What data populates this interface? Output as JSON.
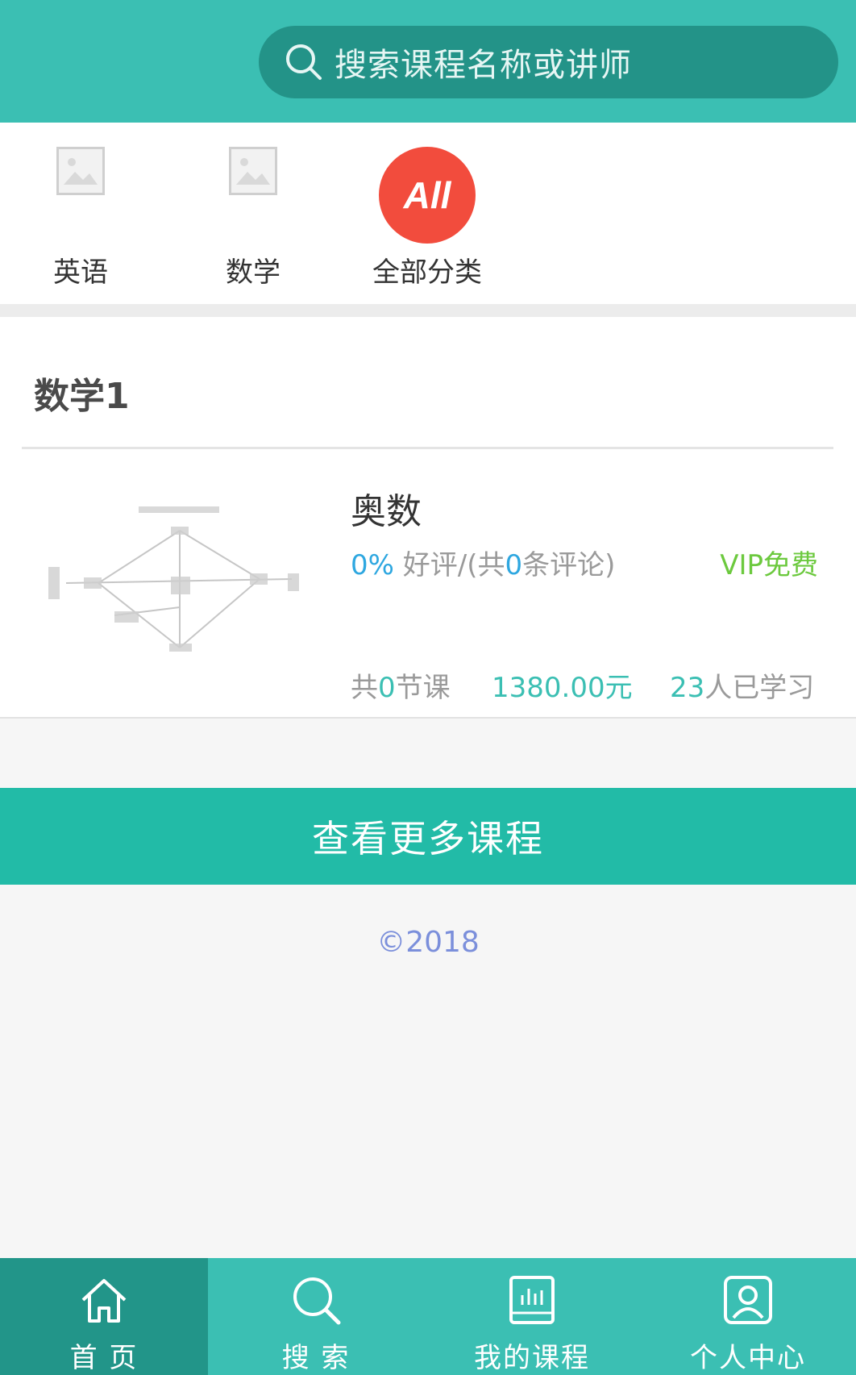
{
  "header": {
    "search": {
      "placeholder": "搜索课程名称或讲师",
      "icon": "search-icon"
    },
    "colors": {
      "bar": "#3bbfb3",
      "search_bg": "#239388"
    }
  },
  "categories": [
    {
      "label": "英语",
      "icon": "image-placeholder-icon"
    },
    {
      "label": "数学",
      "icon": "image-placeholder-icon"
    },
    {
      "label": "全部分类",
      "icon": "all-categories-icon",
      "badge_text": "All"
    }
  ],
  "section": {
    "title": "数学1",
    "course": {
      "name": "奥数",
      "rating_percent": "0%",
      "rating_text_a": " 好评/(共",
      "review_count": "0",
      "rating_text_b": "条评论)",
      "vip": "VIP免费",
      "lessons_prefix": "共",
      "lessons_count": "0",
      "lessons_suffix": "节课",
      "price": "1380.00元",
      "learners_count": "23",
      "learners_suffix": "人已学习"
    }
  },
  "more_button": "查看更多课程",
  "footer": {
    "copyright": "©2018"
  },
  "tabbar": [
    {
      "label": "首 页",
      "icon": "home-icon",
      "active": true
    },
    {
      "label": "搜 索",
      "icon": "search-icon",
      "active": false
    },
    {
      "label": "我的课程",
      "icon": "book-icon",
      "active": false
    },
    {
      "label": "个人中心",
      "icon": "user-icon",
      "active": false
    }
  ]
}
